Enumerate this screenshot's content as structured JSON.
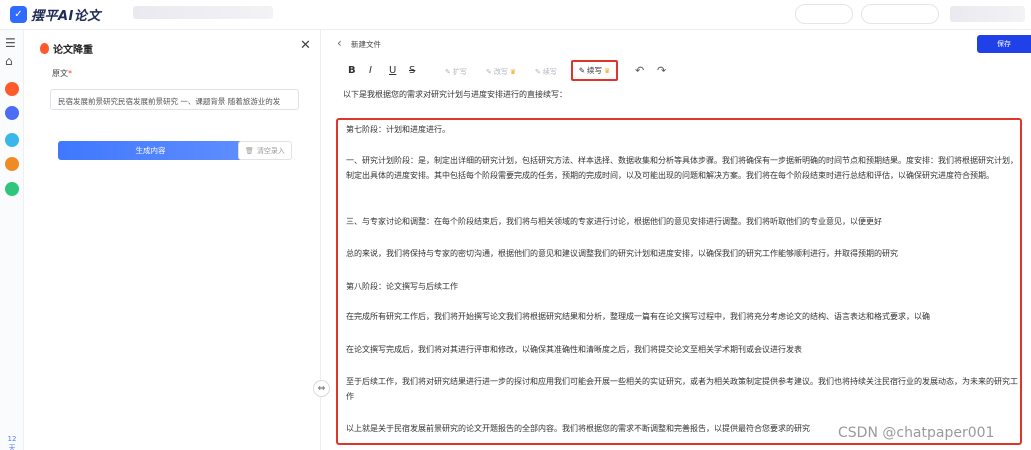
{
  "app": {
    "title": "摆平AI论文",
    "logo_icon": "shield-logo-icon"
  },
  "rail": {
    "items": [
      {
        "icon": "menu-icon",
        "glyph": "☰"
      },
      {
        "icon": "home-icon",
        "glyph": "⌂"
      },
      {
        "icon": "fire-icon",
        "color": "#ff5a2c"
      },
      {
        "icon": "tool-icon",
        "color": "#4b6cf5"
      },
      {
        "icon": "tool-icon",
        "color": "#39b7e8"
      },
      {
        "icon": "tool-icon",
        "color": "#f08a24"
      },
      {
        "icon": "tool-icon",
        "color": "#2fc57a"
      }
    ],
    "footer": "12\n天"
  },
  "panel": {
    "title": "论文降重",
    "close": "✕",
    "field_label": "原文",
    "required_mark": "*",
    "source_text": "民宿发展前景研究民宿发展前景研究 一、课题背景 随着旅游业的发",
    "generate_label": "生成内容",
    "clear_label": "清空录入"
  },
  "doc": {
    "back": "‹",
    "name": "新建文件",
    "save_label": "保存"
  },
  "toolbar": {
    "bold": "B",
    "italic": "I",
    "underline": "U",
    "strike": "S",
    "expand": "扩写",
    "polish": "改写",
    "continue": "续写",
    "active": "续写",
    "undo": "↶",
    "redo": "↷"
  },
  "content": {
    "intro": "以下是我根据您的需求对研究计划与进度安排进行的直接续写：",
    "paragraphs": [
      "第七阶段：计划和进度进行。",
      "一、研究计划阶段：是，制定出详细的研究计划，包括研究方法、样本选择、数据收集和分析等具体步骤。我们将确保有一步据新明确的时间节点和预期结果。度安排：我们将根据研究计划，制定出具体的进度安排。其中包括每个阶段需要完成的任务，预期的完成时间，以及可能出现的问题和解决方案。我们将在每个阶段结束时进行总结和评估，以确保研究进度符合预期。",
      "三、与专家讨论和调整：在每个阶段结束后，我们将与相关领域的专家进行讨论，根据他们的意见安排进行调整。我们将听取他们的专业意见，以便更好",
      "总的来说，我们将保持与专家的密切沟通，根据他们的意见和建议调整我们的研究计划和进度安排，以确保我们的研究工作能够顺利进行，并取得预期的研究",
      "第八阶段：论文撰写与后续工作",
      "在完成所有研究工作后，我们将开始撰写论文我们将根据研究结果和分析，整理成一篇有在论文撰写过程中，我们将充分考虑论文的结构、语言表达和格式要求，以确",
      "在论文撰写完成后，我们将对其进行评审和修改，以确保其准确性和清晰度之后，我们将提交论文至相关学术期刊或会议进行发表",
      "至于后续工作，我们将对研究结果进行进一步的探讨和应用我们可能会开展一些相关的实证研究，或者为相关政策制定提供参考建议。我们也将持续关注民宿行业的发展动态，为未来的研究工作",
      "以上就是关于民宿发展前景研究的论文开题报告的全部内容。我们将根据您的需求不断调整和完善报告，以提供最符合您要求的研究"
    ]
  },
  "watermark": "CSDN @chatpaper001",
  "colors": {
    "accent": "#2f6bff",
    "highlight": "#e0352b",
    "save": "#2141e8"
  }
}
